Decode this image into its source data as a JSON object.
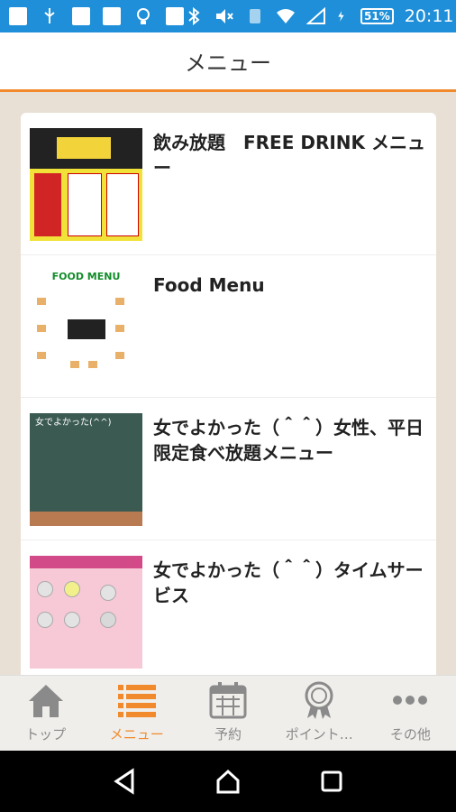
{
  "status": {
    "time": "20:11",
    "battery": "51%"
  },
  "header": {
    "title": "メニュー"
  },
  "menu_items": [
    {
      "title": "飲み放題　FREE DRINK メニュー"
    },
    {
      "title": "Food Menu"
    },
    {
      "title": "女でよかった（＾＾）女性、平日限定食べ放題メニュー"
    },
    {
      "title": "女でよかった（＾＾）タイムサービス"
    }
  ],
  "thumbs": {
    "food_menu_banner": "FOOD MENU",
    "women_board": "女でよかった(^^)"
  },
  "tabs": [
    {
      "label": "トップ",
      "icon": "home-icon"
    },
    {
      "label": "メニュー",
      "icon": "list-icon"
    },
    {
      "label": "予約",
      "icon": "calendar-icon"
    },
    {
      "label": "ポイント…",
      "icon": "medal-icon"
    },
    {
      "label": "その他",
      "icon": "more-icon"
    }
  ],
  "colors": {
    "accent": "#f08a2c",
    "statusbar": "#1e8fd8"
  }
}
